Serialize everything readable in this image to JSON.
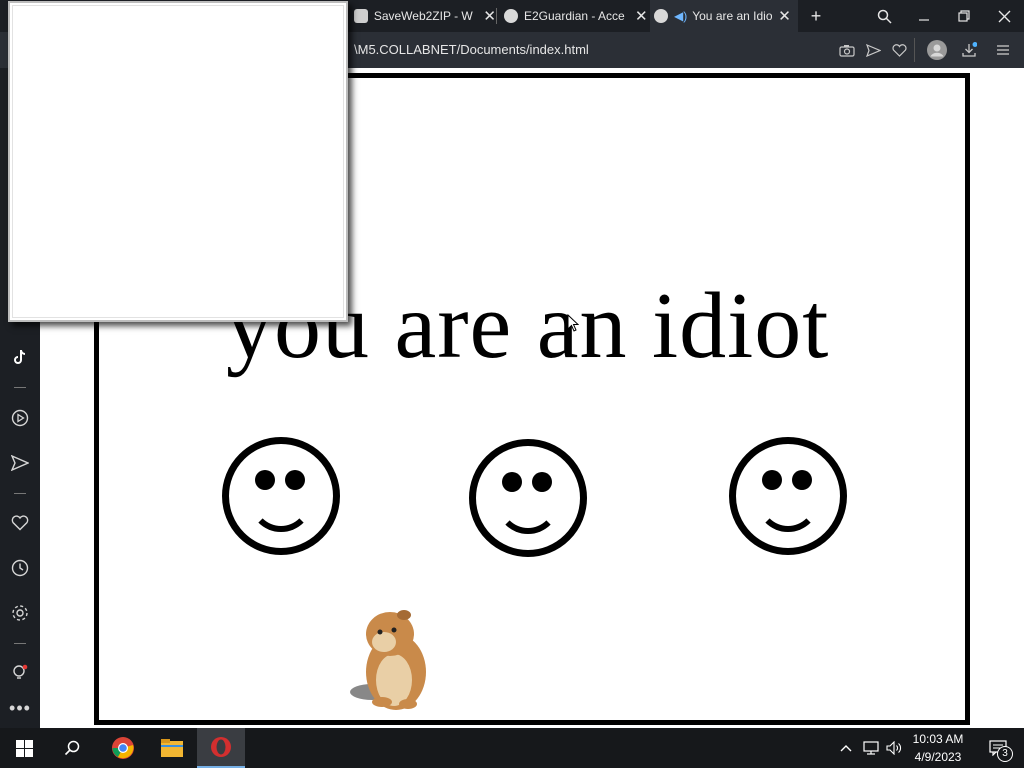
{
  "browser": {
    "tabs": [
      {
        "title": "SaveWeb2ZIP - W",
        "close": "✕"
      },
      {
        "title": "E2Guardian - Acce",
        "close": "✕"
      },
      {
        "title": "You are an Idio",
        "close": "✕",
        "active": true
      }
    ],
    "new_tab": "+",
    "url": "\\M5.COLLABNET/Documents/index.html"
  },
  "page": {
    "headline": "you are an idiot",
    "smiley_count": 3
  },
  "taskbar": {
    "time": "10:03 AM",
    "date": "4/9/2023",
    "notification_count": "3"
  },
  "colors": {
    "chrome_dark": "#1c1f24",
    "chrome_mid": "#2b2f36",
    "taskbar": "#16181b",
    "accent_opera": "#d32f2f"
  }
}
